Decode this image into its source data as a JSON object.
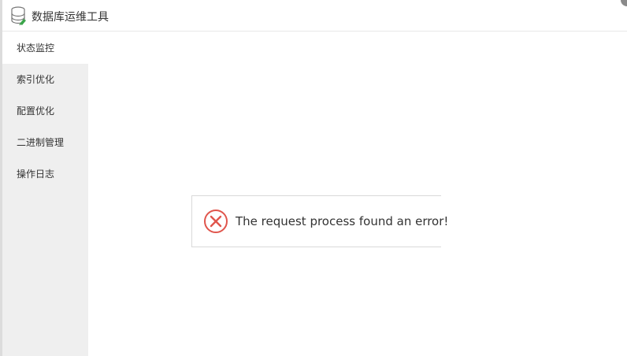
{
  "header": {
    "title": "数据库运维工具",
    "icon": "database-icon"
  },
  "sidebar": {
    "items": [
      {
        "label": "状态监控",
        "active": true
      },
      {
        "label": "索引优化",
        "active": false
      },
      {
        "label": "配置优化",
        "active": false
      },
      {
        "label": "二进制管理",
        "active": false
      },
      {
        "label": "操作日志",
        "active": false
      }
    ]
  },
  "message": {
    "text": "The request process found an error!",
    "icon": "error-circle-x-icon",
    "color": "#e0554c"
  }
}
